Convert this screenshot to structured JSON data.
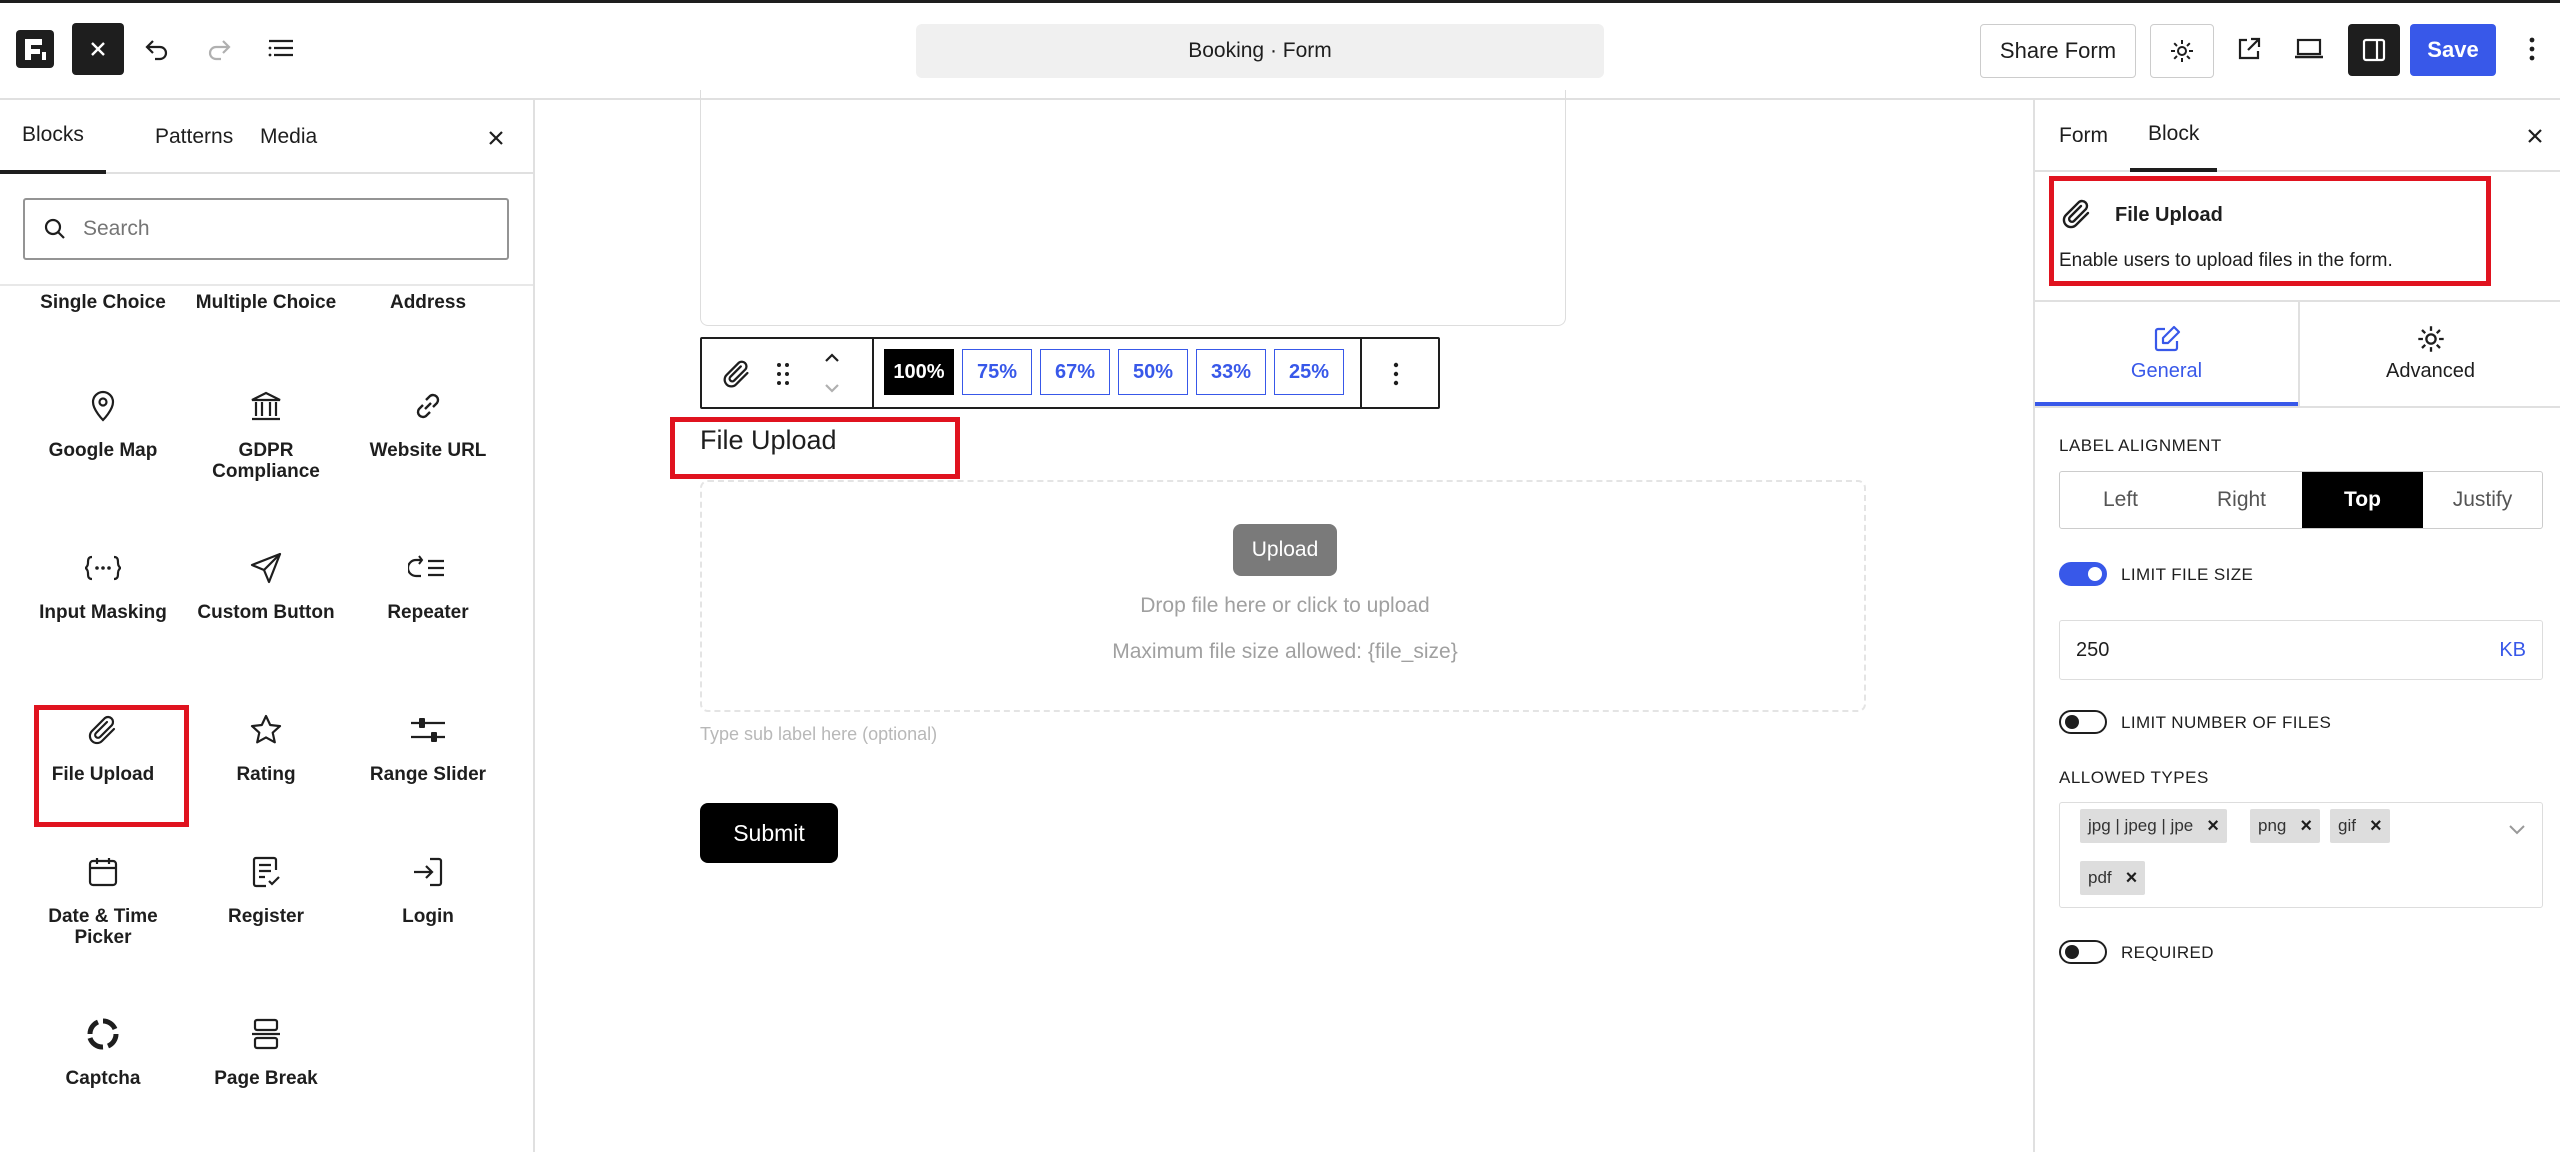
{
  "header": {
    "title": "Booking · Form",
    "share_label": "Share Form",
    "save_label": "Save"
  },
  "left_panel": {
    "tabs": [
      "Blocks",
      "Patterns",
      "Media"
    ],
    "search_placeholder": "Search",
    "blocks": [
      {
        "label": "Single Choice",
        "icon": "single-choice-icon"
      },
      {
        "label": "Multiple Choice",
        "icon": "multiple-choice-icon"
      },
      {
        "label": "Address",
        "icon": "address-icon"
      },
      {
        "label": "Google Map",
        "icon": "map-pin-icon"
      },
      {
        "label": "GDPR Compliance",
        "icon": "bank-icon"
      },
      {
        "label": "Website URL",
        "icon": "link-icon"
      },
      {
        "label": "Input Masking",
        "icon": "input-mask-icon"
      },
      {
        "label": "Custom Button",
        "icon": "send-icon"
      },
      {
        "label": "Repeater",
        "icon": "repeater-icon"
      },
      {
        "label": "File Upload",
        "icon": "paperclip-icon"
      },
      {
        "label": "Rating",
        "icon": "star-icon"
      },
      {
        "label": "Range Slider",
        "icon": "slider-icon"
      },
      {
        "label": "Date & Time Picker",
        "icon": "calendar-icon"
      },
      {
        "label": "Register",
        "icon": "register-icon"
      },
      {
        "label": "Login",
        "icon": "login-icon"
      },
      {
        "label": "Captcha",
        "icon": "captcha-icon"
      },
      {
        "label": "Page Break",
        "icon": "page-break-icon"
      }
    ]
  },
  "canvas": {
    "width_options": [
      "100%",
      "75%",
      "67%",
      "50%",
      "33%",
      "25%"
    ],
    "active_width": "100%",
    "field_label": "File Upload",
    "upload_button": "Upload",
    "drop_text": "Drop file here or click to upload",
    "max_size_text": "Maximum file size allowed: {file_size}",
    "sub_label_placeholder": "Type sub label here (optional)",
    "submit_label": "Submit"
  },
  "right_panel": {
    "tabs": [
      "Form",
      "Block"
    ],
    "active_tab": "Block",
    "block_name": "File Upload",
    "block_description": "Enable users to upload files in the form.",
    "settings_tabs": [
      "General",
      "Advanced"
    ],
    "label_alignment_title": "LABEL ALIGNMENT",
    "alignment_options": [
      "Left",
      "Right",
      "Top",
      "Justify"
    ],
    "active_alignment": "Top",
    "limit_file_size_label": "LIMIT FILE SIZE",
    "limit_file_size_on": true,
    "file_size_value": "250",
    "file_size_unit": "KB",
    "limit_number_label": "LIMIT NUMBER OF FILES",
    "limit_number_on": false,
    "allowed_types_title": "ALLOWED TYPES",
    "allowed_types": [
      "jpg | jpeg | jpe",
      "png",
      "gif",
      "pdf"
    ],
    "required_label": "REQUIRED",
    "required_on": false
  },
  "colors": {
    "accent": "#3858e9",
    "highlight": "#e0131f",
    "dark": "#1e1e1e"
  }
}
